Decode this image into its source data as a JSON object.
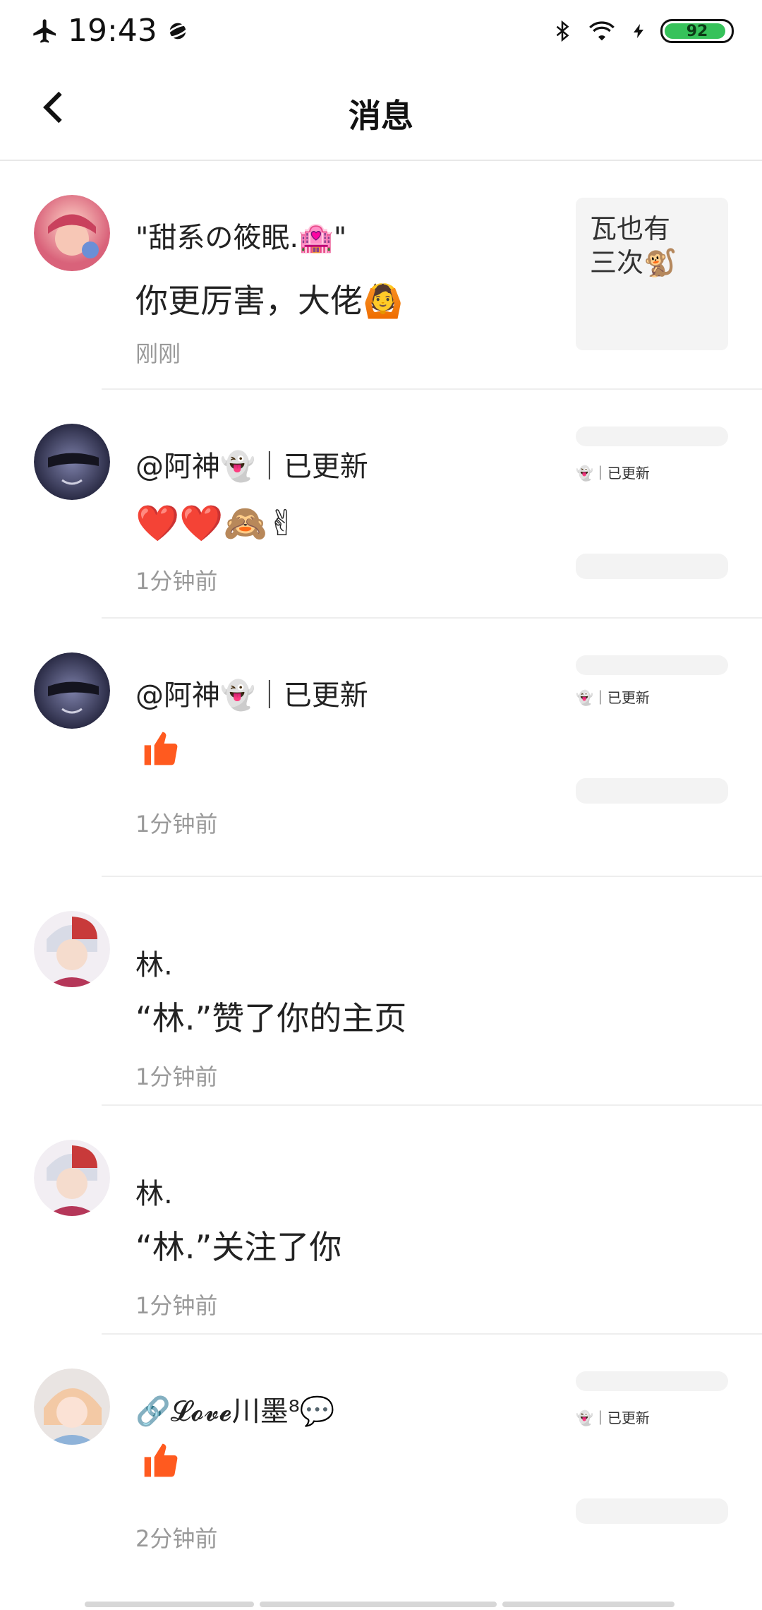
{
  "status": {
    "time": "19:43",
    "battery": 92
  },
  "header": {
    "title": "消息"
  },
  "messages": [
    {
      "name": "\"甜系の筱眠.🏩\"",
      "text": "你更厉害，大佬🙆",
      "time": "刚刚",
      "thumb_text": "瓦也有\n三次🐒"
    },
    {
      "name": "@阿神👻｜已更新",
      "text": "❤️❤️🙈✌",
      "time": "1分钟前",
      "thumb_text": "👻｜已更新"
    },
    {
      "name": "@阿神👻｜已更新",
      "text": "",
      "time": "1分钟前",
      "thumb_text": "👻｜已更新"
    },
    {
      "name": "林.",
      "text": "“林.”赞了你的主页",
      "time": "1分钟前"
    },
    {
      "name": "林.",
      "text": "“林.”关注了你",
      "time": "1分钟前"
    },
    {
      "name": "🔗𝓛𝓸𝓿𝓮川墨⁸💬",
      "text": "",
      "time": "2分钟前",
      "thumb_text": "👻｜已更新"
    }
  ],
  "colors": {
    "like": "#ff5a1f",
    "muted": "#999999"
  }
}
